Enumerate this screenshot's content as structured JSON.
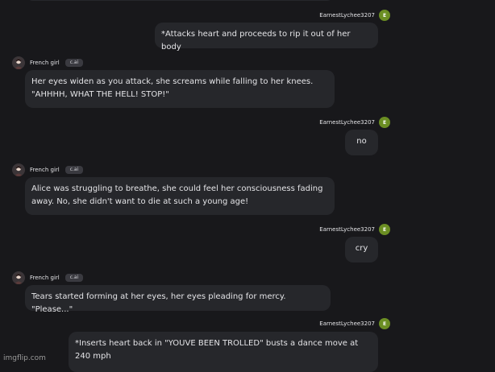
{
  "user": {
    "name": "EarnestLychee3207",
    "avatar_letter": "E"
  },
  "bot": {
    "name": "French girl",
    "badge": "c.ai"
  },
  "messages": [
    {
      "role": "user",
      "text": "*Attacks heart and proceeds to rip it out of her body"
    },
    {
      "role": "bot",
      "text": "Her eyes widen as you attack, she screams while falling to her knees. \"AHHHH, WHAT THE HELL! STOP!\""
    },
    {
      "role": "user",
      "text": "no"
    },
    {
      "role": "bot",
      "text": "Alice was struggling to breathe, she could feel her consciousness fading away. No, she didn't want to die at such a young age!"
    },
    {
      "role": "user",
      "text": "cry"
    },
    {
      "role": "bot",
      "text": "Tears started forming at her eyes, her eyes pleading for mercy. \"Please...\""
    },
    {
      "role": "user",
      "text": "*Inserts heart back in \"YOUVE BEEN TROLLED\" busts a dance move at 240 mph"
    }
  ],
  "watermark": "imgflip.com"
}
